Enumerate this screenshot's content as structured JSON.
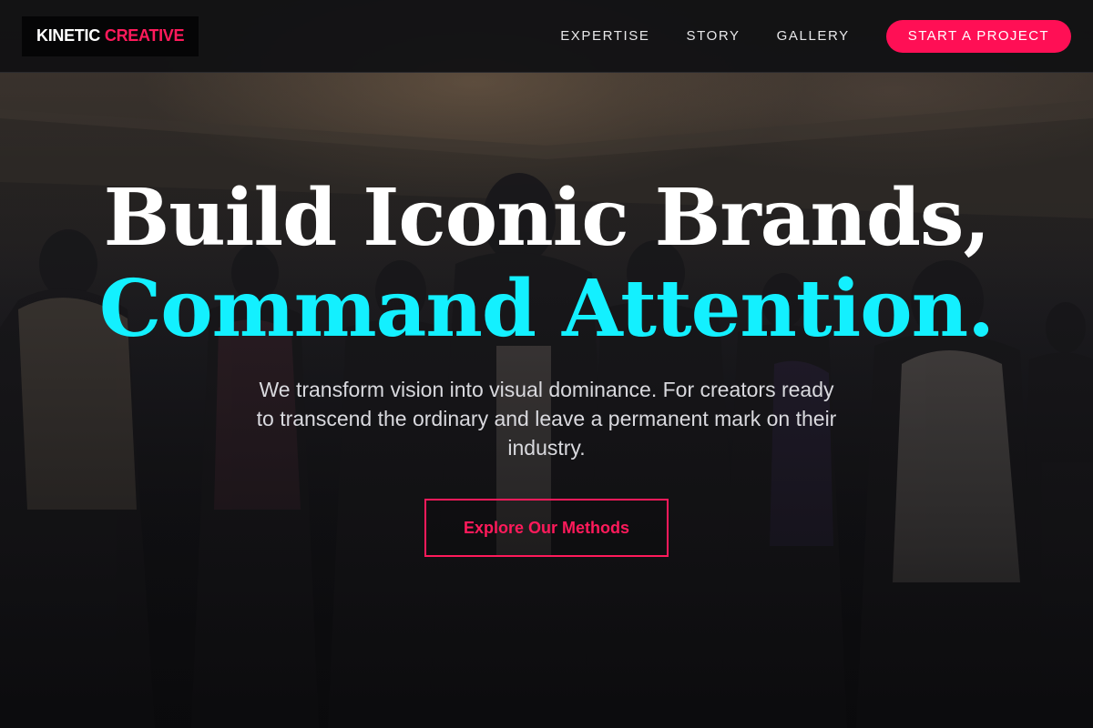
{
  "header": {
    "logo": {
      "word1": "KINETIC",
      "word2": "CREATIVE"
    },
    "nav": [
      {
        "label": "EXPERTISE"
      },
      {
        "label": "STORY"
      },
      {
        "label": "GALLERY"
      }
    ],
    "cta_label": "START A PROJECT"
  },
  "hero": {
    "headline_line1": "Build Iconic Brands,",
    "headline_line2": "Command Attention.",
    "subtext": "We transform vision into visual dominance. For creators ready to transcend the ordinary and leave a permanent mark on their industry.",
    "button_label": "Explore Our Methods"
  },
  "colors": {
    "accent_pink": "#ff0f55",
    "accent_cyan": "#13f0ff",
    "header_bg": "#121214",
    "text_light": "#ffffff"
  }
}
